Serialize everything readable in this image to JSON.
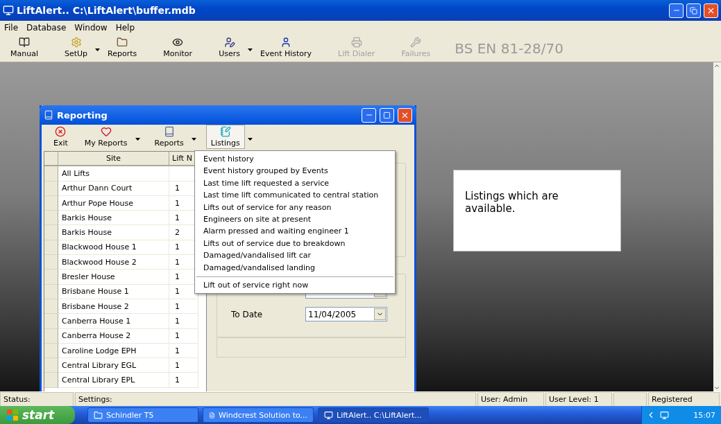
{
  "window": {
    "title": "LiftAlert.. C:\\LiftAlert\\buffer.mdb"
  },
  "menu": [
    "File",
    "Database",
    "Window",
    "Help"
  ],
  "toolbar": [
    {
      "label": "Manual",
      "caret": false,
      "disabled": false
    },
    {
      "label": "SetUp",
      "caret": true,
      "disabled": false
    },
    {
      "label": "Reports",
      "caret": false,
      "disabled": false
    },
    {
      "label": "Monitor",
      "caret": false,
      "disabled": false
    },
    {
      "label": "Users",
      "caret": true,
      "disabled": false
    },
    {
      "label": "Event History",
      "caret": false,
      "disabled": false
    },
    {
      "label": "Lift Dialer",
      "caret": false,
      "disabled": true
    },
    {
      "label": "Failures",
      "caret": false,
      "disabled": true
    }
  ],
  "standard": "BS EN 81-28/70",
  "reporting": {
    "title": "Reporting",
    "toolbar": [
      {
        "label": "Exit",
        "caret": false,
        "selected": false
      },
      {
        "label": "My Reports",
        "caret": true,
        "selected": false
      },
      {
        "label": "Reports",
        "caret": true,
        "selected": false
      },
      {
        "label": "Listings",
        "caret": true,
        "selected": true
      }
    ],
    "table": {
      "columns": [
        "Site",
        "Lift N"
      ],
      "rows": [
        {
          "site": "All Lifts",
          "lift": ""
        },
        {
          "site": "Arthur Dann Court",
          "lift": "1"
        },
        {
          "site": "Arthur Pope House",
          "lift": "1"
        },
        {
          "site": "Barkis House",
          "lift": "1"
        },
        {
          "site": "Barkis House",
          "lift": "2"
        },
        {
          "site": "Blackwood House 1",
          "lift": "1"
        },
        {
          "site": "Blackwood House 2",
          "lift": "1"
        },
        {
          "site": "Bresler House",
          "lift": "1"
        },
        {
          "site": "Brisbane House 1",
          "lift": "1"
        },
        {
          "site": "Brisbane House 2",
          "lift": "1"
        },
        {
          "site": "Canberra House 1",
          "lift": "1"
        },
        {
          "site": "Canberra House 2",
          "lift": "1"
        },
        {
          "site": "Caroline Lodge EPH",
          "lift": "1"
        },
        {
          "site": "Central Library EGL",
          "lift": "1"
        },
        {
          "site": "Central Library EPL",
          "lift": "1"
        }
      ]
    },
    "to_date": {
      "label": "To Date",
      "value": "11/04/2005"
    },
    "listings_menu": [
      {
        "label": "Event history",
        "separator_before": false
      },
      {
        "label": "Event history grouped by Events",
        "separator_before": false
      },
      {
        "label": "Last time lift requested a service",
        "separator_before": false
      },
      {
        "label": "Last time lift communicated to central station",
        "separator_before": false
      },
      {
        "label": "Lifts out of service for any reason",
        "separator_before": false
      },
      {
        "label": "Engineers on site at present",
        "separator_before": false
      },
      {
        "label": "Alarm pressed and waiting engineer 1",
        "separator_before": false
      },
      {
        "label": "Lifts out of service due to breakdown",
        "separator_before": false
      },
      {
        "label": "Damaged/vandalised lift car",
        "separator_before": false
      },
      {
        "label": "Damaged/vandalised landing",
        "separator_before": false
      },
      {
        "label": "Lift out of service right now",
        "separator_before": true
      }
    ]
  },
  "callout": "Listings which are available.",
  "status_bar": [
    "Status:",
    "Settings:",
    "User: Admin",
    "User Level: 1",
    "Registered"
  ],
  "taskbar": {
    "start": "start",
    "tasks": [
      {
        "label": "Schindler T5",
        "selected": false
      },
      {
        "label": "Windcrest Solution to...",
        "selected": false
      },
      {
        "label": "LiftAlert.. C:\\LiftAlert...",
        "selected": true
      }
    ],
    "clock": "15:07"
  }
}
